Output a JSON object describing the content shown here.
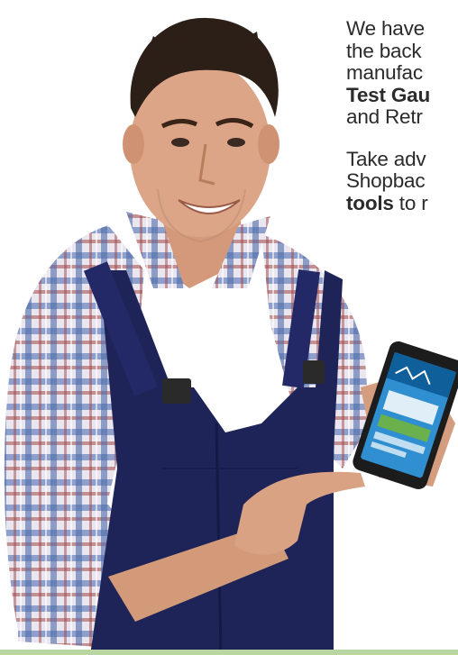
{
  "intro_text": {
    "line1": "We have",
    "line2": "the back",
    "line3": "manufac",
    "line4_bold": "Test Gau",
    "line5": "and Retr"
  },
  "cta_text": {
    "line1": "Take adv",
    "line2": "Shopbac",
    "line3_bold": "tools",
    "line3_rest": " to r"
  },
  "colors": {
    "overalls": "#1e2457",
    "shirt_blue": "#5b7bb3",
    "shirt_red": "#b04a4a",
    "skin": "#d9a07e",
    "hair": "#2c1f17",
    "phone_screen": "#2f8fd1",
    "bottom_strip": "#b9d6a2"
  }
}
